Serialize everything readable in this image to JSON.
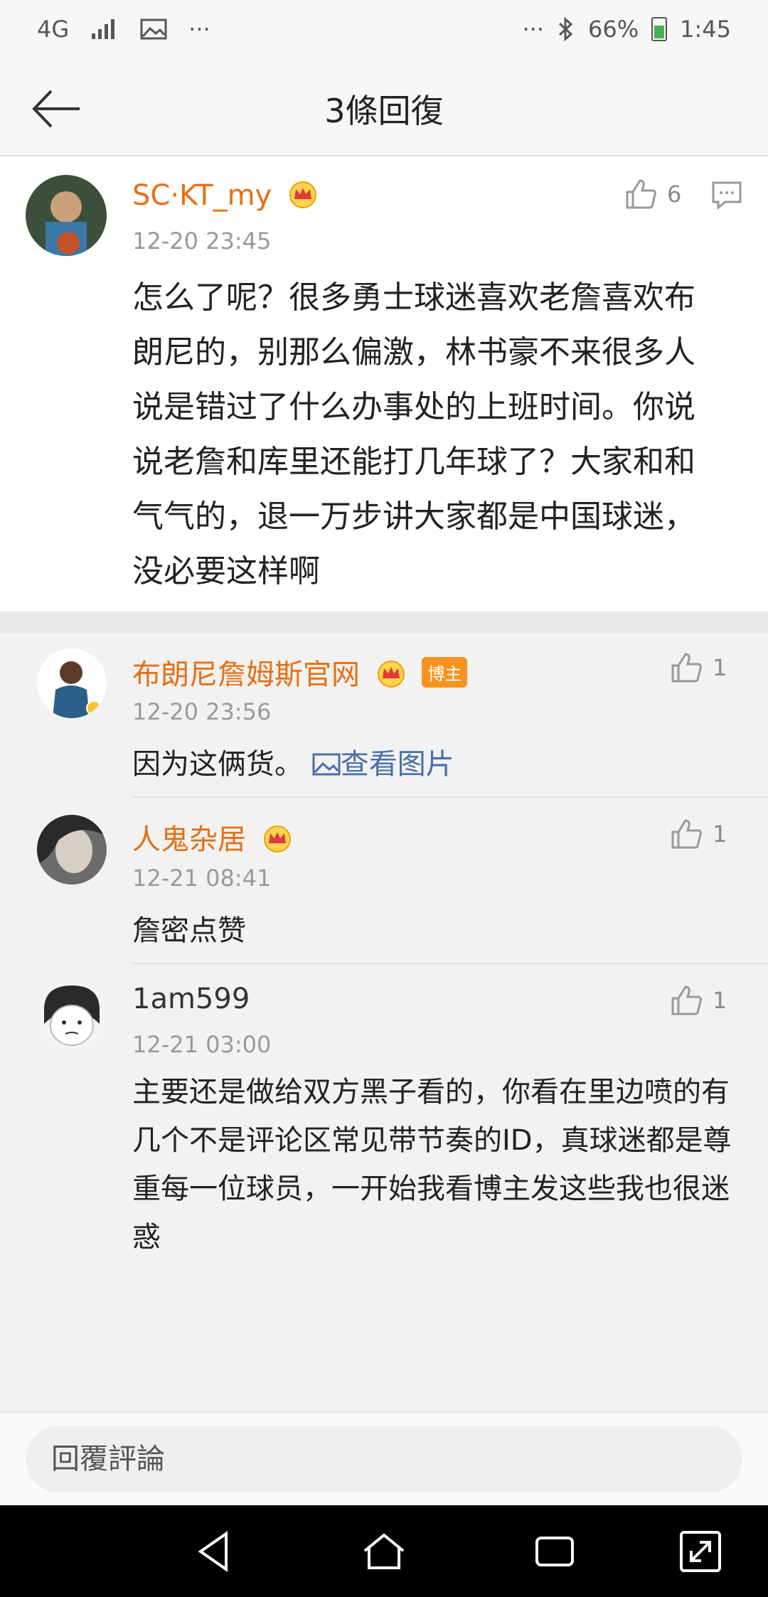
{
  "status_bar": {
    "network": "4G",
    "battery": "66%",
    "time": "1:45",
    "more": "···"
  },
  "header": {
    "title": "3條回復"
  },
  "main_comment": {
    "username": "SC·KT_my",
    "time": "12-20 23:45",
    "likes": "6",
    "text": "怎么了呢？很多勇士球迷喜欢老詹喜欢布朗尼的，别那么偏激，林书豪不来很多人说是错过了什么办事处的上班时间。你说说老詹和库里还能打几年球了？大家和和气气的，退一万步讲大家都是中国球迷，没必要这样啊"
  },
  "replies": [
    {
      "username": "布朗尼詹姆斯官网",
      "badge": "博主",
      "time": "12-20 23:56",
      "likes": "1",
      "text": "因为这俩货。",
      "link": "查看图片"
    },
    {
      "username": "人鬼杂居",
      "time": "12-21 08:41",
      "likes": "1",
      "text": "詹密点赞"
    },
    {
      "username": "1am599",
      "time": "12-21 03:00",
      "likes": "1",
      "text": "主要还是做给双方黑子看的，你看在里边喷的有几个不是评论区常见带节奏的ID，真球迷都是尊重每一位球员，一开始我看博主发这些我也很迷惑"
    }
  ],
  "reply_bar": {
    "placeholder": "回覆評論"
  },
  "colors": {
    "username": "#e86f13",
    "link": "#4a6ea8",
    "badge": "#f7931e"
  }
}
